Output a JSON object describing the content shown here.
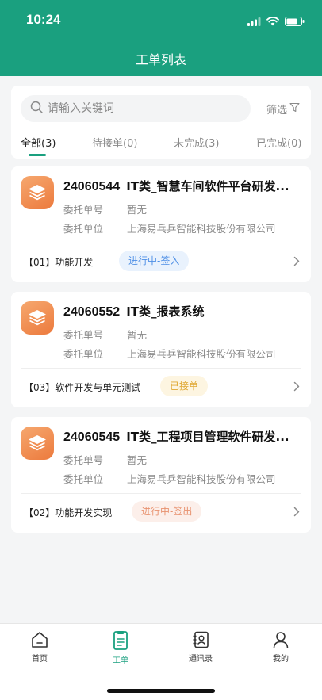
{
  "status_bar": {
    "time": "10:24"
  },
  "header": {
    "title": "工单列表"
  },
  "search": {
    "placeholder": "请输入关键词",
    "filter_label": "筛选"
  },
  "tabs": [
    {
      "label": "全部(3)",
      "active": true
    },
    {
      "label": "待接单(0)",
      "active": false
    },
    {
      "label": "未完成(3)",
      "active": false
    },
    {
      "label": "已完成(0)",
      "active": false
    }
  ],
  "cards": [
    {
      "code": "24060544",
      "title": "IT类_智慧车间软件平台研发...",
      "fields": [
        {
          "label": "委托单号",
          "value": "暂无"
        },
        {
          "label": "委托单位",
          "value": "上海易乓乒智能科技股份有限公司"
        }
      ],
      "stage": "【01】功能开发",
      "status": "进行中-签入",
      "status_color": "#4e8fe6"
    },
    {
      "code": "24060552",
      "title": "IT类_报表系统",
      "fields": [
        {
          "label": "委托单号",
          "value": "暂无"
        },
        {
          "label": "委托单位",
          "value": "上海易乓乒智能科技股份有限公司"
        }
      ],
      "stage": "【03】软件开发与单元测试",
      "status": "已接单",
      "status_color": "#e0a833"
    },
    {
      "code": "24060545",
      "title": "IT类_工程项目管理软件研发...",
      "fields": [
        {
          "label": "委托单号",
          "value": "暂无"
        },
        {
          "label": "委托单位",
          "value": "上海易乓乒智能科技股份有限公司"
        }
      ],
      "stage": "【02】功能开发实现",
      "status": "进行中-签出",
      "status_color": "#e8926f"
    }
  ],
  "bottom_nav": [
    {
      "label": "首页",
      "icon": "home-icon",
      "active": false
    },
    {
      "label": "工单",
      "icon": "work-order-icon",
      "active": true
    },
    {
      "label": "通讯录",
      "icon": "contacts-icon",
      "active": false
    },
    {
      "label": "我的",
      "icon": "user-icon",
      "active": false
    }
  ],
  "colors": {
    "brand": "#1aa07f",
    "background": "#f4f5f6",
    "icon_orange": "#ec7a3d"
  }
}
